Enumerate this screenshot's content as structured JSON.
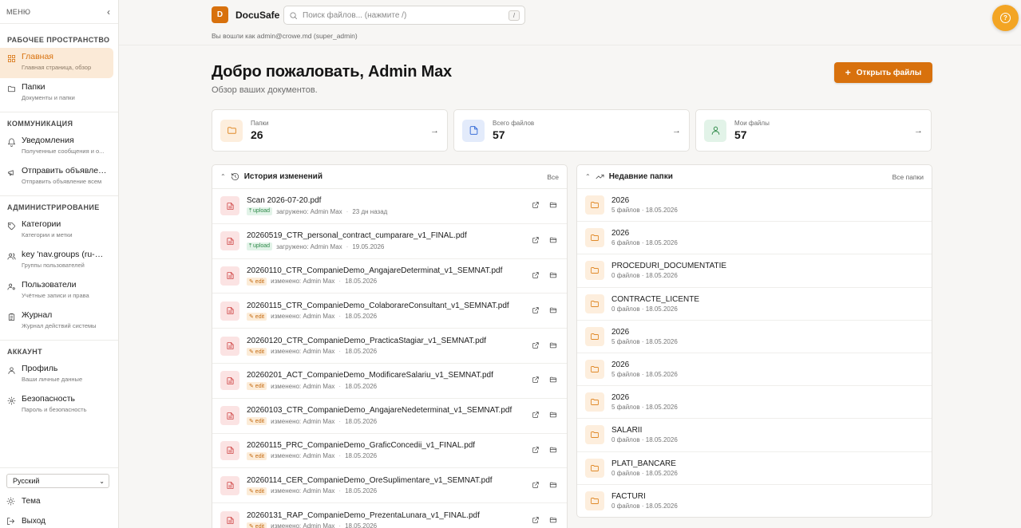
{
  "sidebar": {
    "menu_label": "МЕНЮ",
    "collapse_icon": "chevron-left-icon",
    "sections": [
      {
        "title": "РАБОЧЕЕ ПРОСТРАНСТВО",
        "items": [
          {
            "label": "Главная",
            "sub": "Главная страница, обзор",
            "icon": "grid-icon",
            "active": true
          },
          {
            "label": "Папки",
            "sub": "Документы и папки",
            "icon": "folder-icon"
          }
        ]
      },
      {
        "title": "КОММУНИКАЦИЯ",
        "items": [
          {
            "label": "Уведомления",
            "sub": "Полученные сообщения и о...",
            "icon": "bell-icon"
          },
          {
            "label": "Отправить объявление",
            "sub": "Отправить объявление всем",
            "icon": "megaphone-icon"
          }
        ]
      },
      {
        "title": "АДМИНИСТРИРОВАНИЕ",
        "items": [
          {
            "label": "Категории",
            "sub": "Категории и метки",
            "icon": "tag-icon"
          },
          {
            "label": "key 'nav.groups (ru-RU...",
            "sub": "Группы пользователей",
            "icon": "users-icon"
          },
          {
            "label": "Пользователи",
            "sub": "Учётные записи и права",
            "icon": "user-cog-icon"
          },
          {
            "label": "Журнал",
            "sub": "Журнал действий системы",
            "icon": "clipboard-icon"
          }
        ]
      },
      {
        "title": "АККАУНТ",
        "items": [
          {
            "label": "Профиль",
            "sub": "Ваши личные данные",
            "icon": "user-icon"
          },
          {
            "label": "Безопасность",
            "sub": "Пароль и безопасность",
            "icon": "shield-gear-icon"
          }
        ]
      }
    ],
    "language": "Русский",
    "theme_label": "Тема",
    "logout_label": "Выход"
  },
  "topbar": {
    "logo_letter": "D",
    "brand": "DocuSafe",
    "search_placeholder": "Поиск файлов... (нажмите /)",
    "search_shortcut": "/",
    "logged_in": "Вы вошли как admin@crowe.md (super_admin)",
    "help_icon": "help-circle-icon"
  },
  "header": {
    "title": "Добро пожаловать, Admin Max",
    "subtitle": "Обзор ваших документов.",
    "open_files_label": "Открыть файлы"
  },
  "stats": [
    {
      "label": "Папки",
      "value": "26",
      "icon": "folder-icon",
      "bg": "#fdeedd",
      "color": "#e08a2a"
    },
    {
      "label": "Всего файлов",
      "value": "57",
      "icon": "file-icon",
      "bg": "#e3ebfb",
      "color": "#3b6fd8"
    },
    {
      "label": "Мои файлы",
      "value": "57",
      "icon": "user-icon",
      "bg": "#e2f3e8",
      "color": "#2f8a4a"
    }
  ],
  "history": {
    "title": "История изменений",
    "all_label": "Все",
    "rows": [
      {
        "name": "Scan 2026-07-20.pdf",
        "tag": "upload",
        "action": "загружено: Admin Max",
        "time": "23 дн назад"
      },
      {
        "name": "20260519_CTR_personal_contract_cumparare_v1_FINAL.pdf",
        "tag": "upload",
        "action": "загружено: Admin Max",
        "time": "19.05.2026"
      },
      {
        "name": "20260110_CTR_CompanieDemo_AngajareDeterminat_v1_SEMNAT.pdf",
        "tag": "edit",
        "action": "изменено: Admin Max",
        "time": "18.05.2026"
      },
      {
        "name": "20260115_CTR_CompanieDemo_ColaborareConsultant_v1_SEMNAT.pdf",
        "tag": "edit",
        "action": "изменено: Admin Max",
        "time": "18.05.2026"
      },
      {
        "name": "20260120_CTR_CompanieDemo_PracticaStagiar_v1_SEMNAT.pdf",
        "tag": "edit",
        "action": "изменено: Admin Max",
        "time": "18.05.2026"
      },
      {
        "name": "20260201_ACT_CompanieDemo_ModificareSalariu_v1_SEMNAT.pdf",
        "tag": "edit",
        "action": "изменено: Admin Max",
        "time": "18.05.2026"
      },
      {
        "name": "20260103_CTR_CompanieDemo_AngajareNedeterminat_v1_SEMNAT.pdf",
        "tag": "edit",
        "action": "изменено: Admin Max",
        "time": "18.05.2026"
      },
      {
        "name": "20260115_PRC_CompanieDemo_GraficConcedii_v1_FINAL.pdf",
        "tag": "edit",
        "action": "изменено: Admin Max",
        "time": "18.05.2026"
      },
      {
        "name": "20260114_CER_CompanieDemo_OreSuplimentare_v1_SEMNAT.pdf",
        "tag": "edit",
        "action": "изменено: Admin Max",
        "time": "18.05.2026"
      },
      {
        "name": "20260131_RAP_CompanieDemo_PrezentaLunara_v1_FINAL.pdf",
        "tag": "edit",
        "action": "изменено: Admin Max",
        "time": "18.05.2026"
      }
    ]
  },
  "folders": {
    "title": "Недавние папки",
    "all_label": "Все папки",
    "rows": [
      {
        "name": "2026",
        "meta": "5 файлов · 18.05.2026"
      },
      {
        "name": "2026",
        "meta": "6 файлов · 18.05.2026"
      },
      {
        "name": "PROCEDURI_DOCUMENTATIE",
        "meta": "0 файлов · 18.05.2026"
      },
      {
        "name": "CONTRACTE_LICENTE",
        "meta": "0 файлов · 18.05.2026"
      },
      {
        "name": "2026",
        "meta": "5 файлов · 18.05.2026"
      },
      {
        "name": "2026",
        "meta": "5 файлов · 18.05.2026"
      },
      {
        "name": "2026",
        "meta": "5 файлов · 18.05.2026"
      },
      {
        "name": "SALARII",
        "meta": "0 файлов · 18.05.2026"
      },
      {
        "name": "PLATI_BANCARE",
        "meta": "0 файлов · 18.05.2026"
      },
      {
        "name": "FACTURI",
        "meta": "0 файлов · 18.05.2026"
      }
    ]
  }
}
